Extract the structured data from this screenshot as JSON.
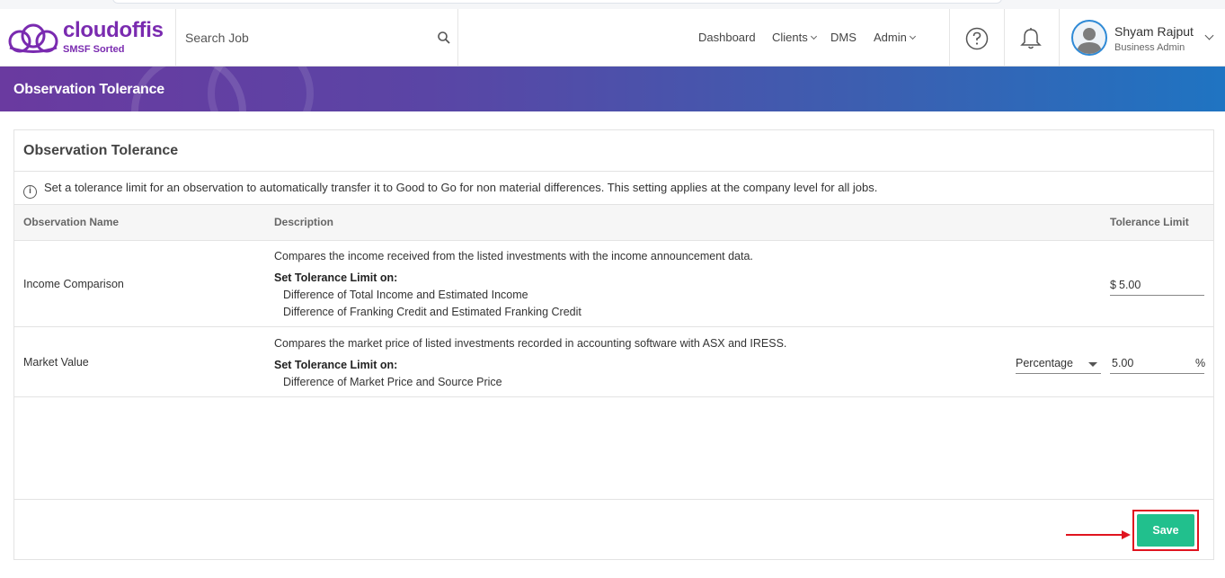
{
  "header": {
    "logo_name": "cloudoffis",
    "logo_tagline": "SMSF Sorted",
    "search_placeholder": "Search Job",
    "nav": [
      {
        "label": "Dashboard"
      },
      {
        "label": "Clients"
      },
      {
        "label": "DMS"
      },
      {
        "label": "Admin"
      }
    ],
    "user_name": "Shyam Rajput",
    "user_role": "Business Admin"
  },
  "banner": {
    "title": "Observation Tolerance"
  },
  "card": {
    "title": "Observation Tolerance",
    "info": "Set a tolerance limit for an observation to automatically transfer it to Good to Go for non material differences. This setting applies at the company level for all jobs.",
    "columns": {
      "name": "Observation Name",
      "description": "Description",
      "limit": "Tolerance Limit"
    },
    "rows": [
      {
        "name": "Income Comparison",
        "description": "Compares the income received from the listed investments with the income announcement data.",
        "set_label": "Set Tolerance Limit on:",
        "items": [
          "Difference of Total Income and Estimated Income",
          "Difference of Franking Credit and Estimated Franking Credit"
        ],
        "prefix": "$",
        "value": "5.00"
      },
      {
        "name": "Market Value",
        "description": "Compares the market price of listed investments recorded in accounting software with ASX and IRESS.",
        "set_label": "Set Tolerance Limit on:",
        "items": [
          "Difference of Market Price and Source Price"
        ],
        "type_select": "Percentage",
        "value": "5.00",
        "suffix": "%"
      }
    ],
    "save_label": "Save"
  },
  "colors": {
    "brand_purple": "#7a2bb0",
    "save_green": "#21c08d",
    "highlight_red": "#e0141f"
  }
}
